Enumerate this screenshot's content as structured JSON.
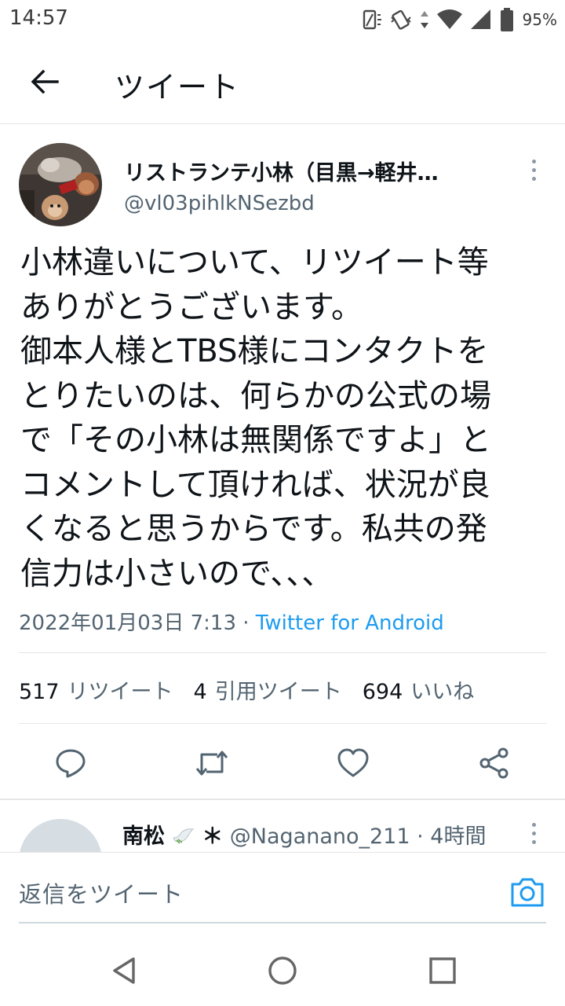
{
  "status_bar": {
    "time": "14:57",
    "battery": "95%"
  },
  "header": {
    "title": "ツイート"
  },
  "tweet": {
    "author_name": "リストランテ小林（目黒→軽井…",
    "author_handle": "@vl03pihlkNSezbd",
    "text_lines": [
      "小林違いについて、リツイート等",
      "ありがとうございます。",
      "御本人様とTBS様にコンタクトを",
      "とりたいのは、何らかの公式の場",
      "で「その小林は無関係ですよ」と",
      "コメントして頂ければ、状況が良",
      "くなると思うからです。私共の発",
      "信力は小さいので、、、"
    ],
    "timestamp": "2022年01月03日 7:13",
    "separator": " · ",
    "source": "Twitter for Android"
  },
  "stats": {
    "retweets_count": "517",
    "retweets_label": "リツイート",
    "quotes_count": "4",
    "quotes_label": "引用ツイート",
    "likes_count": "694",
    "likes_label": "いいね"
  },
  "reply_preview": {
    "name": "南松",
    "name_suffix": "＊",
    "handle_time": "@Naganano_211 · 4時間"
  },
  "composer": {
    "placeholder": "返信をツイート"
  },
  "colors": {
    "accent": "#1d9bf0",
    "secondary_text": "#536471",
    "primary_text": "#0f1419",
    "divider": "#e6e6e6"
  },
  "icons": {
    "back": "arrow-left-icon",
    "more": "more-vertical-icon",
    "reply": "comment-icon",
    "retweet": "retweet-icon",
    "like": "heart-icon",
    "share": "share-icon",
    "camera": "camera-icon",
    "nav_back": "triangle-back-icon",
    "nav_home": "circle-home-icon",
    "nav_recents": "square-recents-icon"
  }
}
